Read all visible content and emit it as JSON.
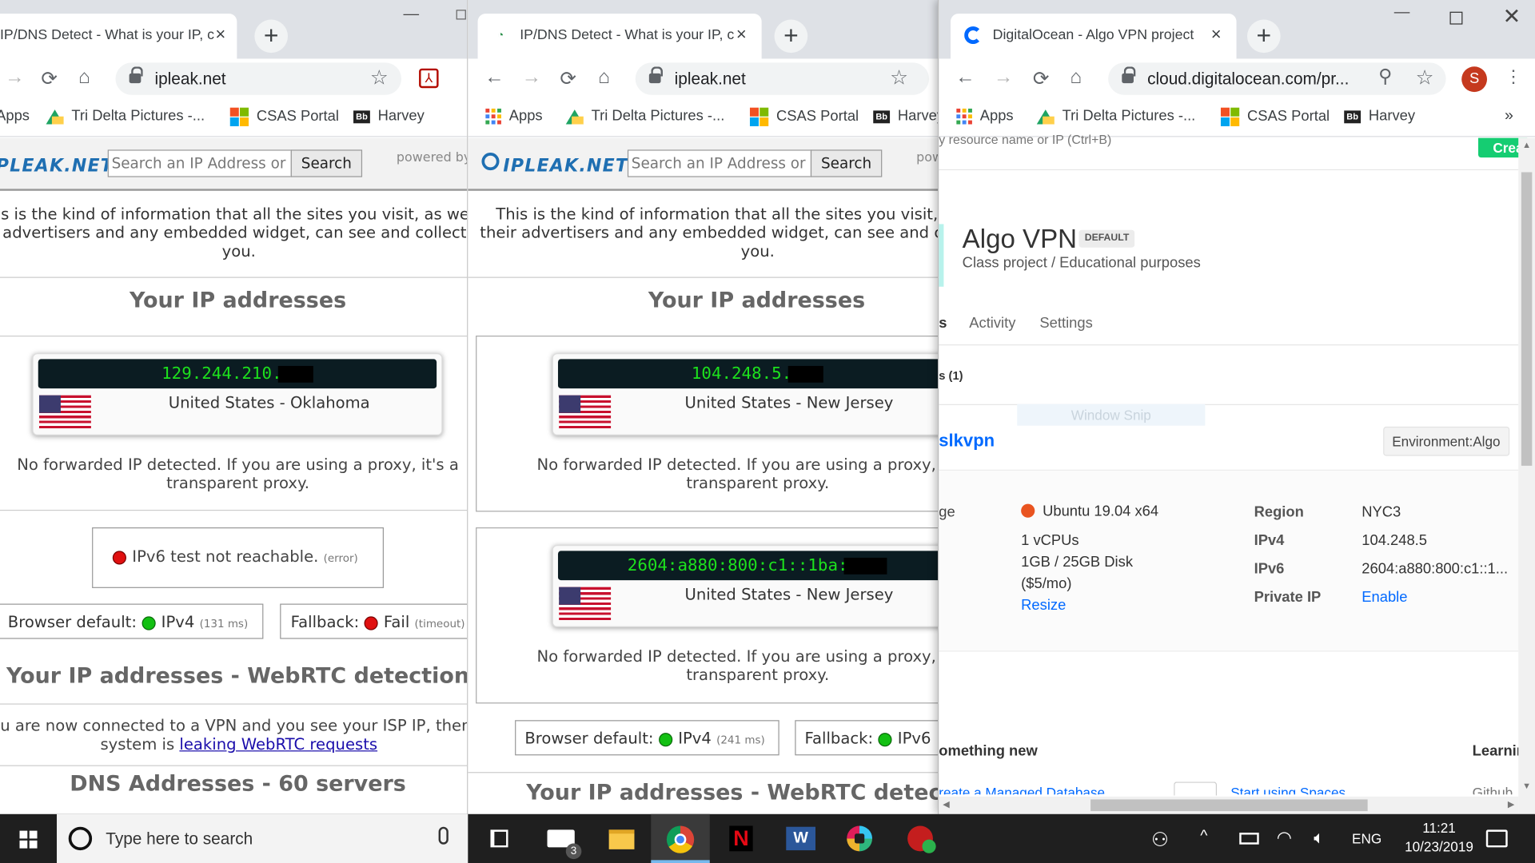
{
  "window1": {
    "tab_title": "IP/DNS Detect - What is your IP, c",
    "url": "ipleak.net",
    "bookmarks": [
      "Apps",
      "Tri Delta Pictures -...",
      "CSAS Portal",
      "Harvey"
    ],
    "logo": "IPLEAK.NET",
    "search_placeholder": "Search an IP Address or",
    "search_button": "Search",
    "powered_by": "powered by",
    "intro_lines": [
      "This is the kind of information that all the sites you visit, as well as",
      "their advertisers and any embedded widget, can see and collect about",
      "you."
    ],
    "ip_heading": "Your IP addresses",
    "ip_value": "129.244.210.",
    "ip_location": "United States - Oklahoma",
    "forward_lines": [
      "No forwarded IP detected. If you are using a proxy, it's a",
      "transparent proxy."
    ],
    "ipv6_status": "IPv6 test not reachable.",
    "ipv6_note": "(error)",
    "browser_default_label": "Browser default:",
    "browser_default_value": "IPv4",
    "browser_default_ms": "(131 ms)",
    "fallback_label": "Fallback:",
    "fallback_value": "Fail",
    "fallback_note": "(timeout)",
    "webrtc_heading": "Your IP addresses - WebRTC detection",
    "webrtc_line1": "If you are now connected to a VPN and you see your ISP IP, then your",
    "webrtc_line2_prefix": "system is",
    "webrtc_link": "leaking WebRTC requests",
    "dns_heading": "DNS Addresses - 60 servers"
  },
  "window2": {
    "tab_title": "IP/DNS Detect - What is your IP, c",
    "url": "ipleak.net",
    "bookmarks": [
      "Apps",
      "Tri Delta Pictures -...",
      "CSAS Portal",
      "Harvey"
    ],
    "logo": "IPLEAK.NET",
    "search_placeholder": "Search an IP Address or",
    "search_button": "Search",
    "powered_by": "powered by",
    "intro_lines": [
      "This is the kind of information that all the sites you visit, as well as",
      "their advertisers and any embedded widget, can see and collect about",
      "you."
    ],
    "ip_heading": "Your IP addresses",
    "ipv4_value": "104.248.5.",
    "ipv4_location": "United States - New Jersey",
    "forward_lines": [
      "No forwarded IP detected. If you are using a proxy, it's a",
      "transparent proxy."
    ],
    "ipv6_value": "2604:a880:800:c1::1ba:",
    "ipv6_location": "United States - New Jersey",
    "browser_default_label": "Browser default:",
    "browser_default_value": "IPv4",
    "browser_default_ms": "(241 ms)",
    "fallback_label": "Fallback:",
    "fallback_value": "IPv6",
    "webrtc_heading": "Your IP addresses - WebRTC detection"
  },
  "window3": {
    "tab_title": "DigitalOcean - Algo VPN project",
    "url": "cloud.digitalocean.com/pr...",
    "avatar_letter": "S",
    "bookmarks": [
      "Apps",
      "Tri Delta Pictures -...",
      "CSAS Portal",
      "Harvey"
    ],
    "search_hint": "y resource name or IP (Ctrl+B)",
    "create_button": "Crea",
    "project_name": "Algo VPN",
    "project_badge": "DEFAULT",
    "project_desc": "Class project / Educational purposes",
    "tabs": [
      "s",
      "Activity",
      "Settings"
    ],
    "resources_count": "s (1)",
    "window_snip": "Window Snip",
    "droplet_name": "slkvpn",
    "droplet_tag": "Environment:Algo",
    "image_label": "ge",
    "os": "Ubuntu 19.04 x64",
    "cpus": "1 vCPUs",
    "disk": "1GB / 25GB Disk",
    "price": "($5/mo)",
    "resize": "Resize",
    "region_label": "Region",
    "region_value": "NYC3",
    "ipv4_label": "IPv4",
    "ipv4_value": "104.248.5",
    "ipv6_label": "IPv6",
    "ipv6_value": "2604:a880:800:c1::1...",
    "private_ip_label": "Private IP",
    "private_ip_value": "Enable",
    "something_new": "omething new",
    "learning": "Learnin",
    "link1": "reate a Managed Database",
    "link2": "Start using Spaces",
    "link3": "Github"
  },
  "taskbar": {
    "search_placeholder": "Type here to search",
    "mail_badge": "3",
    "language": "ENG",
    "time": "11:21",
    "date": "10/23/2019"
  },
  "colors": {
    "ip_green": "#1de11d",
    "ip_bg": "#0b1c22",
    "do_blue": "#0069ff",
    "taskbar": "#1f1f1f"
  }
}
